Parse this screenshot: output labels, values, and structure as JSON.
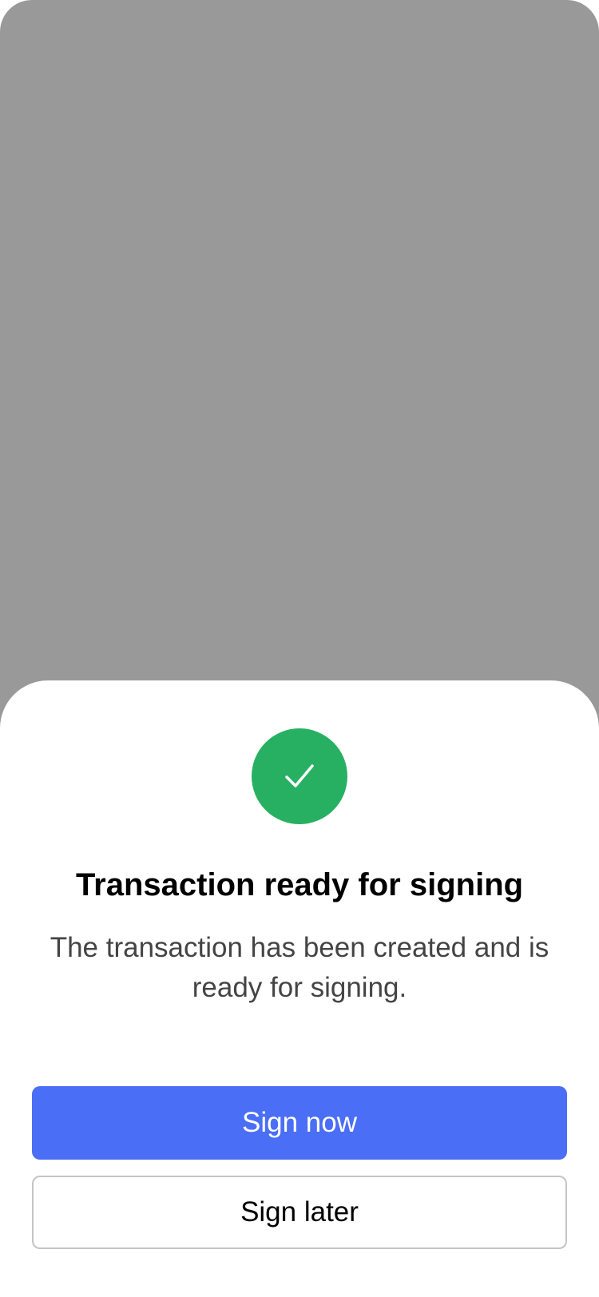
{
  "sheet": {
    "title": "Transaction ready for signing",
    "description": "The transaction has been created and is ready for signing.",
    "status_icon": "checkmark-icon",
    "status_color": "#28b062"
  },
  "actions": {
    "primary_label": "Sign now",
    "secondary_label": "Sign later",
    "primary_color": "#4a6ef5"
  },
  "colors": {
    "backdrop": "#999999",
    "sheet_background": "#ffffff"
  }
}
